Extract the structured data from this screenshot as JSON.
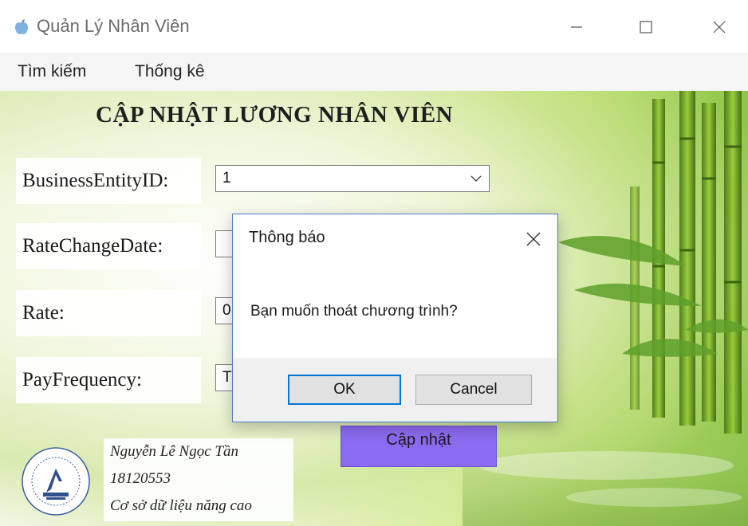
{
  "window": {
    "title": "Quản Lý Nhân Viên",
    "icons": {
      "app": "apple-icon",
      "minimize": "minimize-icon",
      "maximize": "maximize-icon",
      "close": "close-icon"
    }
  },
  "menu": [
    "Tìm kiếm",
    "Thống kê"
  ],
  "form": {
    "title": "CẬP NHẬT LƯƠNG NHÂN VIÊN",
    "fields": [
      {
        "label": "BusinessEntityID:",
        "value": "1"
      },
      {
        "label": "RateChangeDate:",
        "value": ""
      },
      {
        "label": "Rate:",
        "value": "0."
      },
      {
        "label": "PayFrequency:",
        "value": "T"
      }
    ],
    "update_button": "Cập nhật"
  },
  "author": {
    "name": "Nguyễn Lê Ngọc Tần",
    "student_id": "18120553",
    "course": "Cơ sở dữ liệu năng cao"
  },
  "dialog": {
    "title": "Thông báo",
    "message": "Bạn muốn thoát chương trình?",
    "ok": "OK",
    "cancel": "Cancel"
  },
  "colors": {
    "update_button": "#8b6bf0",
    "dialog_border": "#4a7cc9",
    "ok_focus": "#0078d7"
  }
}
